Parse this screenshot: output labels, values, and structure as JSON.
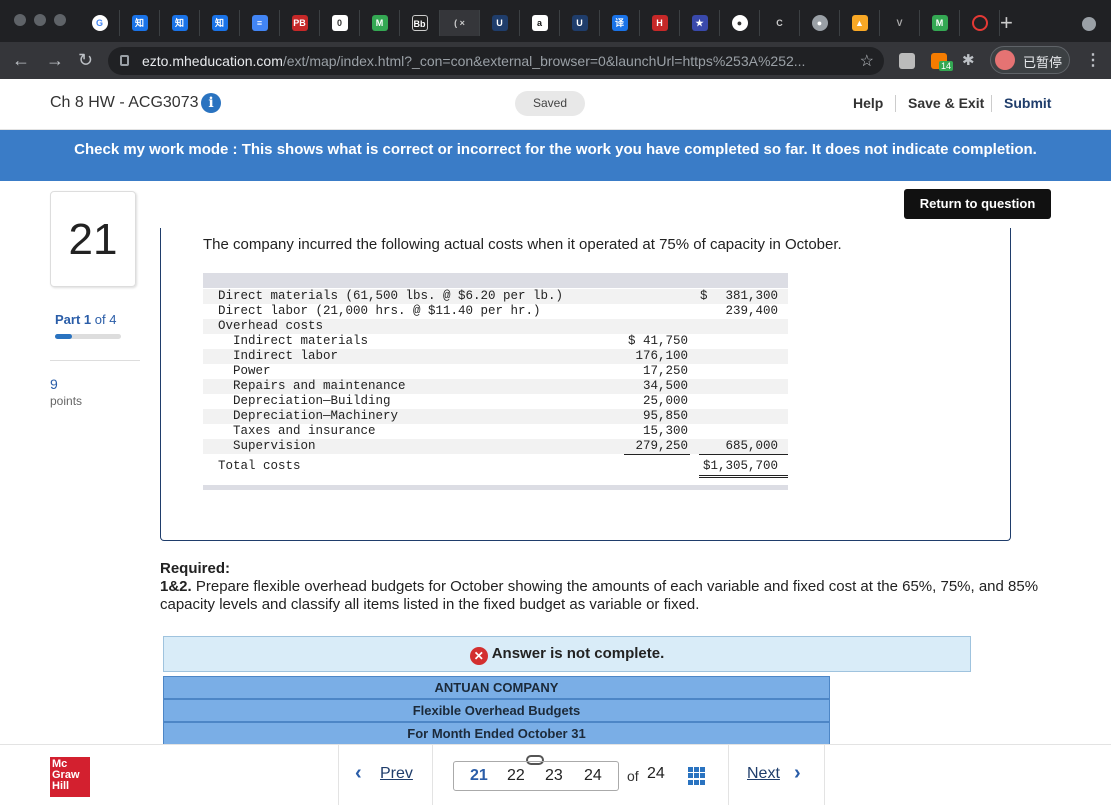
{
  "browser": {
    "url_host": "ezto.mheducation.com",
    "url_path": "/ext/map/index.html?_con=con&external_browser=0&launchUrl=https%253A%252...",
    "profile_label": "已暂停",
    "extension_badge": "14"
  },
  "header": {
    "title": "Ch 8 HW - ACG3073",
    "saved_label": "Saved",
    "help_label": "Help",
    "save_exit_label": "Save & Exit",
    "submit_label": "Submit"
  },
  "banner": {
    "text": "Check my work mode : This shows what is correct or incorrect for the work you have completed so far. It does not indicate completion."
  },
  "sidebar": {
    "question_number": "21",
    "part_label": "Part 1",
    "part_of": "of 4",
    "part_progress": 0.25,
    "points": "9",
    "points_label": "points"
  },
  "question": {
    "return_label": "Return to question",
    "intro": "The company incurred the following actual costs when it operated at 75% of capacity in October.",
    "rows": [
      {
        "label": "Direct materials (61,500 lbs. @ $6.20 per lb.)",
        "indent": 0,
        "c1": "",
        "dollar": "$",
        "c2": "381,300"
      },
      {
        "label": "Direct labor (21,000 hrs. @ $11.40 per hr.)",
        "indent": 0,
        "c1": "",
        "dollar": "",
        "c2": "239,400"
      },
      {
        "label": "Overhead costs",
        "indent": 0,
        "c1": "",
        "dollar": "",
        "c2": ""
      },
      {
        "label": "Indirect materials",
        "indent": 1,
        "c1": "$ 41,750",
        "dollar": "",
        "c2": ""
      },
      {
        "label": "Indirect labor",
        "indent": 1,
        "c1": "176,100",
        "dollar": "",
        "c2": ""
      },
      {
        "label": "Power",
        "indent": 1,
        "c1": "17,250",
        "dollar": "",
        "c2": ""
      },
      {
        "label": "Repairs and maintenance",
        "indent": 1,
        "c1": "34,500",
        "dollar": "",
        "c2": ""
      },
      {
        "label": "Depreciation—Building",
        "indent": 1,
        "c1": "25,000",
        "dollar": "",
        "c2": ""
      },
      {
        "label": "Depreciation—Machinery",
        "indent": 1,
        "c1": "95,850",
        "dollar": "",
        "c2": ""
      },
      {
        "label": "Taxes and insurance",
        "indent": 1,
        "c1": "15,300",
        "dollar": "",
        "c2": ""
      },
      {
        "label": "Supervision",
        "indent": 1,
        "c1": "279,250",
        "dollar": "",
        "c2": "685,000"
      },
      {
        "label": "Total costs",
        "indent": 0,
        "c1": "",
        "dollar": "",
        "c2": "$1,305,700"
      }
    ]
  },
  "required": {
    "heading": "Required:",
    "item_num": "1&2.",
    "item_text": " Prepare flexible overhead budgets for October showing the amounts of each variable and fixed cost at the 65%, 75%, and 85% capacity levels and classify all items listed in the fixed budget as variable or fixed."
  },
  "answer": {
    "status": "Answer is not complete.",
    "budget_lines": [
      "ANTUAN COMPANY",
      "Flexible Overhead Budgets",
      "For Month Ended October 31"
    ]
  },
  "footer": {
    "prev_label": "Prev",
    "next_label": "Next",
    "pages": [
      "21",
      "22",
      "23",
      "24"
    ],
    "current": "21",
    "of_label": "of",
    "total": "24"
  }
}
